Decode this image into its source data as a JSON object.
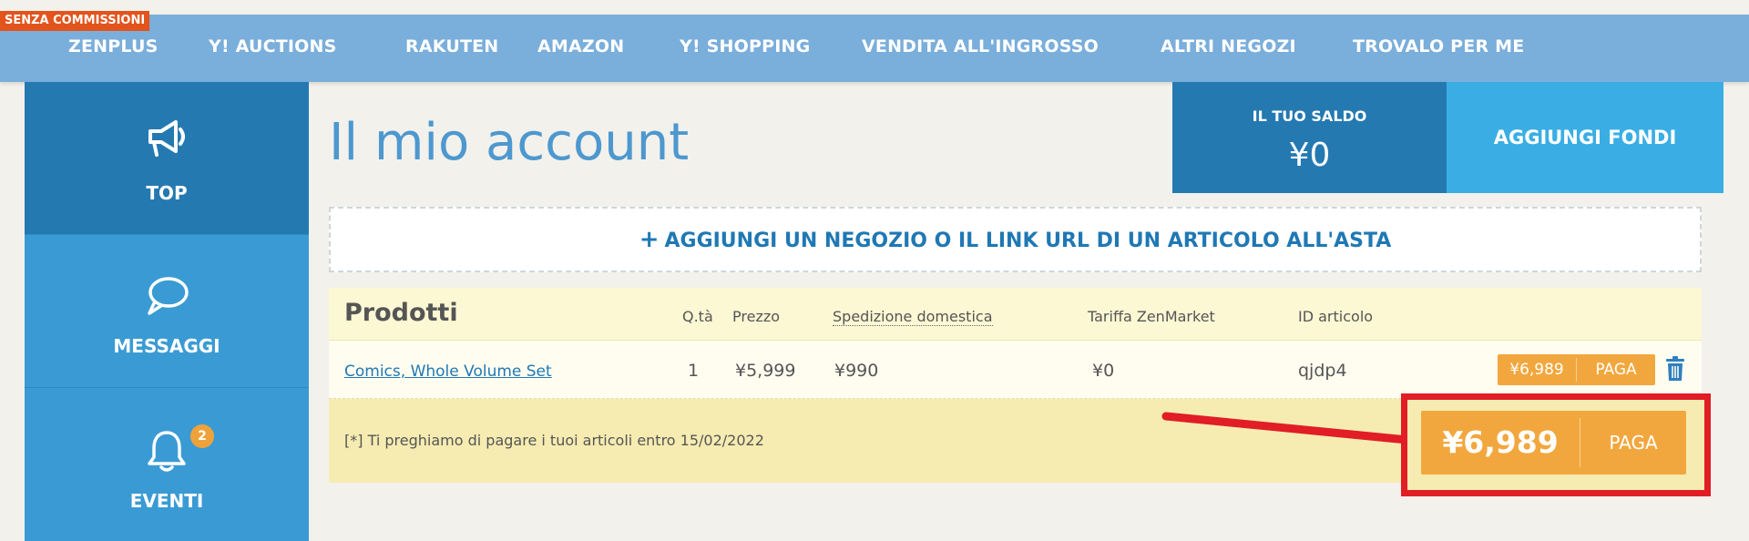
{
  "nav": {
    "badge": "SENZA COMMISSIONI",
    "items": [
      {
        "label": "ZENPLUS"
      },
      {
        "label": "Y! AUCTIONS"
      },
      {
        "label": "RAKUTEN"
      },
      {
        "label": "AMAZON"
      },
      {
        "label": "Y! SHOPPING"
      },
      {
        "label": "VENDITA ALL'INGROSSO"
      },
      {
        "label": "ALTRI NEGOZI"
      },
      {
        "label": "TROVALO PER ME"
      }
    ]
  },
  "sidebar": {
    "items": [
      {
        "label": "TOP",
        "icon": "megaphone-icon"
      },
      {
        "label": "MESSAGGI",
        "icon": "speech-bubble-icon"
      },
      {
        "label": "EVENTI",
        "icon": "bell-icon",
        "badge": "2"
      }
    ]
  },
  "header": {
    "title": "Il mio account",
    "balance_label": "IL TUO SALDO",
    "balance_value": "¥0",
    "add_funds_label": "AGGIUNGI FONDI"
  },
  "add_link": {
    "label": "AGGIUNGI UN NEGOZIO O IL LINK URL DI UN ARTICOLO ALL'ASTA"
  },
  "products": {
    "title": "Prodotti",
    "columns": {
      "qty": "Q.tà",
      "price": "Prezzo",
      "domestic_shipping": "Spedizione domestica",
      "fee": "Tariffa ZenMarket",
      "item_id": "ID articolo"
    },
    "rows": [
      {
        "name": "Comics, Whole Volume Set",
        "qty": "1",
        "price": "¥5,999",
        "shipping": "¥990",
        "fee": "¥0",
        "item_id": "qjdp4",
        "total": "¥6,989",
        "pay_label": "PAGA"
      }
    ],
    "footer_note": "[*] Ti preghiamo di pagare i tuoi articoli entro 15/02/2022",
    "total": "¥6,989",
    "pay_label": "PAGA"
  },
  "colors": {
    "nav_bg": "#7aaedb",
    "sidebar_active": "#2579b1",
    "sidebar_bg": "#3a9bd4",
    "accent_orange": "#f2a73e",
    "highlight_red": "#e11d25"
  }
}
